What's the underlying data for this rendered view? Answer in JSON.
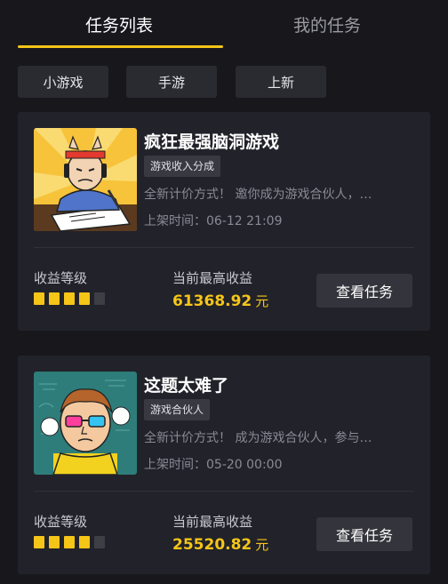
{
  "tabs": [
    {
      "label": "任务列表",
      "active": true
    },
    {
      "label": "我的任务",
      "active": false
    }
  ],
  "filters": [
    "小游戏",
    "手游",
    "上新"
  ],
  "colors": {
    "accent": "#f5c518",
    "bar_on": "#f5c518",
    "bar_off": "#3e3e45"
  },
  "tasks": [
    {
      "title": "疯狂最强脑洞游戏",
      "tag": "游戏收入分成",
      "desc": "全新计价方式！ 邀你成为游戏合伙人，…",
      "time": "上架时间：06-12 21:09",
      "level_label": "收益等级",
      "level": 4,
      "level_max": 5,
      "earn_label": "当前最高收益",
      "earn_value": "61368.92",
      "earn_unit": "元",
      "button": "查看任务",
      "thumb_icon": "cartoon-student-writing-image"
    },
    {
      "title": "这题太难了",
      "tag": "游戏合伙人",
      "desc": "全新计价方式！ 成为游戏合伙人，参与…",
      "time": "上架时间：05-20 00:00",
      "level_label": "收益等级",
      "level": 4,
      "level_max": 5,
      "earn_label": "当前最高收益",
      "earn_value": "25520.82",
      "earn_unit": "元",
      "button": "查看任务",
      "thumb_icon": "cartoon-man-3d-glasses-image"
    }
  ]
}
